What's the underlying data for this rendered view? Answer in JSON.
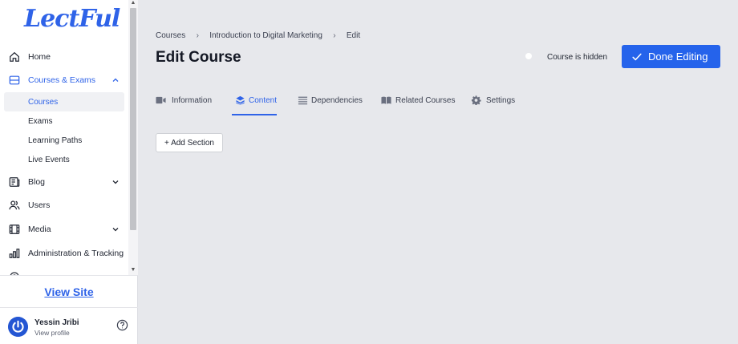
{
  "brand": {
    "logo_text": "LectFul",
    "accent": "#2f63e8"
  },
  "sidebar": {
    "items": [
      {
        "label": "Home",
        "icon": "home-icon"
      },
      {
        "label": "Courses & Exams",
        "icon": "courses-icon",
        "expanded": true,
        "children": [
          {
            "label": "Courses",
            "active": true
          },
          {
            "label": "Exams"
          },
          {
            "label": "Learning Paths"
          },
          {
            "label": "Live Events"
          }
        ]
      },
      {
        "label": "Blog",
        "icon": "blog-icon"
      },
      {
        "label": "Users",
        "icon": "users-icon"
      },
      {
        "label": "Media",
        "icon": "media-icon"
      },
      {
        "label": "Administration & Tracking",
        "icon": "chart-icon"
      }
    ],
    "view_site": "View Site",
    "user": {
      "name": "Yessin Jribi",
      "subtitle": "View profile"
    }
  },
  "breadcrumb": [
    "Courses",
    "Introduction to Digital Marketing",
    "Edit"
  ],
  "page_title": "Edit Course",
  "visibility": {
    "label": "Course is hidden",
    "enabled": false
  },
  "done_button": "Done Editing",
  "tabs": [
    {
      "label": "Information",
      "icon": "video-icon"
    },
    {
      "label": "Content",
      "icon": "layers-icon",
      "active": true
    },
    {
      "label": "Dependencies",
      "icon": "list-icon"
    },
    {
      "label": "Related Courses",
      "icon": "book-icon"
    },
    {
      "label": "Settings",
      "icon": "gear-icon"
    }
  ],
  "add_section": "+ Add Section"
}
